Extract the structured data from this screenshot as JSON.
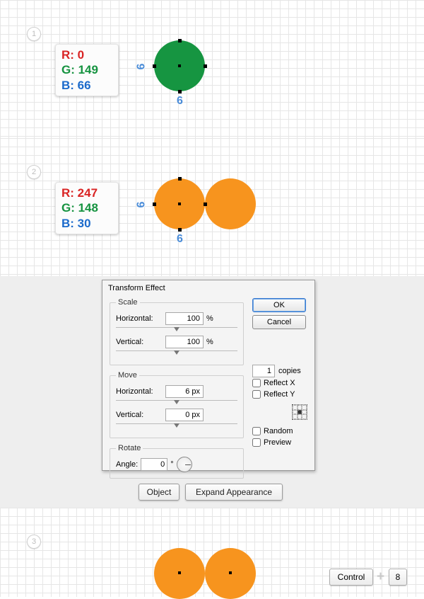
{
  "steps": {
    "s1": "1",
    "s2": "2",
    "s3": "3"
  },
  "rgb1": {
    "r": "R: 0",
    "g": "G: 149",
    "b": "B: 66"
  },
  "rgb2": {
    "r": "R: 247",
    "g": "G: 148",
    "b": "B: 30"
  },
  "dims": {
    "left": "6",
    "bottom": "6"
  },
  "dialog": {
    "title": "Transform Effect",
    "scale_legend": "Scale",
    "move_legend": "Move",
    "rotate_legend": "Rotate",
    "horizontal_label": "Horizontal:",
    "vertical_label": "Vertical:",
    "scale_h": "100",
    "scale_v": "100",
    "percent": "%",
    "move_h": "6 px",
    "move_v": "0 px",
    "angle_label": "Angle:",
    "angle_value": "0",
    "degree": "°",
    "ok": "OK",
    "cancel": "Cancel",
    "copies": "1",
    "copies_label": "copies",
    "reflect_x": "Reflect X",
    "reflect_y": "Reflect Y",
    "random": "Random",
    "preview": "Preview"
  },
  "menu": {
    "object": "Object",
    "expand": "Expand Appearance"
  },
  "shortcut": {
    "control": "Control",
    "key": "8"
  }
}
